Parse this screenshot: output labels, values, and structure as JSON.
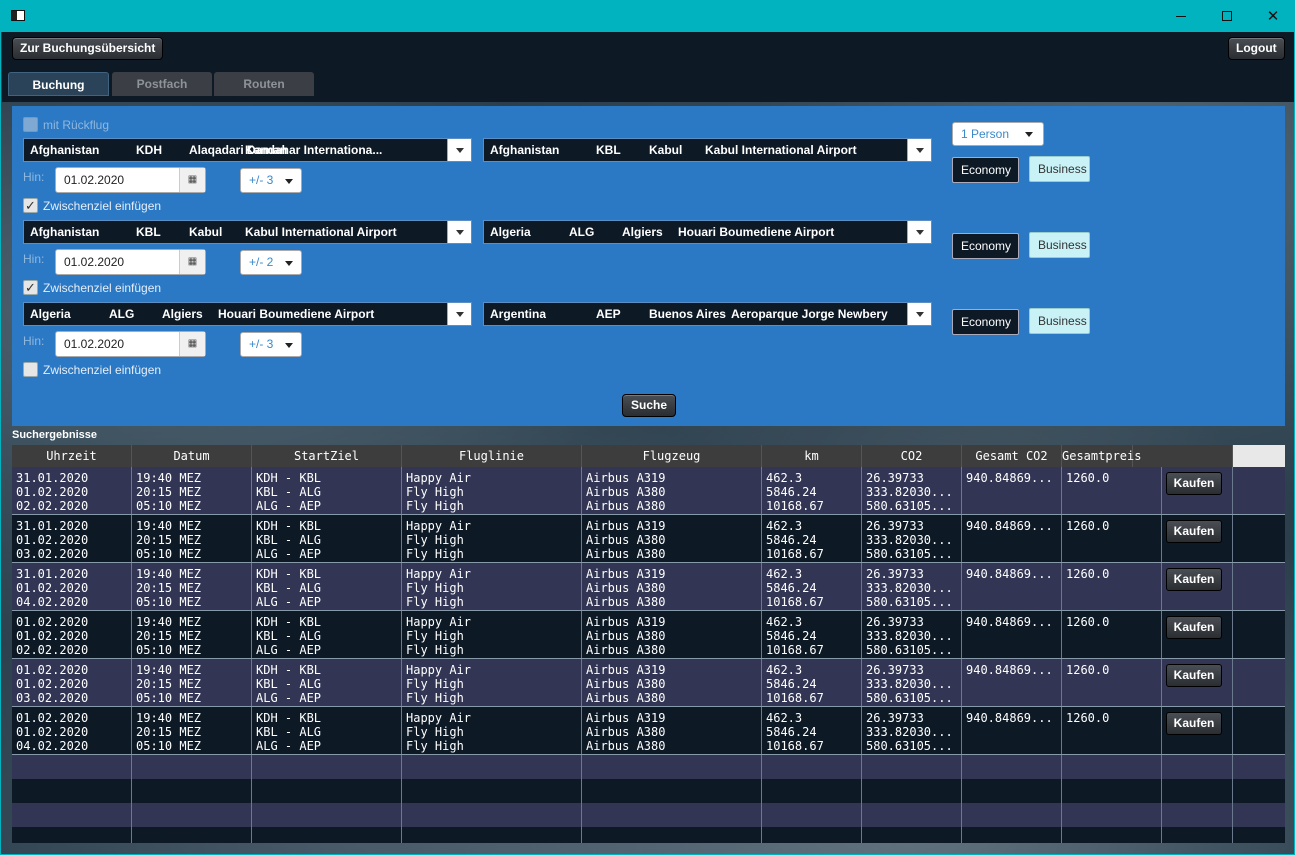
{
  "window": {
    "app_icon": "window-icon",
    "controls": {
      "minimize": "minimize-icon",
      "maximize": "maximize-icon",
      "close": "close-icon",
      "close_glyph": "✕"
    }
  },
  "header": {
    "overview_button": "Zur Buchungsübersicht",
    "logout_button": "Logout"
  },
  "tabs": [
    {
      "label": "Buchung",
      "active": true
    },
    {
      "label": "Postfach",
      "active": false
    },
    {
      "label": "Routen",
      "active": false
    }
  ],
  "search": {
    "return_flight_label": "mit Rückflug",
    "return_flight_checked": false,
    "persons": "1 Person",
    "hin_label": "Hin:",
    "stopover_label": "Zwischenziel einfügen",
    "economy_label": "Economy",
    "business_label": "Business",
    "search_button": "Suche",
    "legs": [
      {
        "from": {
          "country": "Afghanistan",
          "code": "KDH",
          "city": "Alaqadari Daman",
          "airport": "Kandahar Internationa..."
        },
        "to": {
          "country": "Afghanistan",
          "code": "KBL",
          "city": "Kabul",
          "airport": "Kabul International Airport"
        },
        "date": "01.02.2020",
        "flex": "+/- 3",
        "stopover_checked": true
      },
      {
        "from": {
          "country": "Afghanistan",
          "code": "KBL",
          "city": "Kabul",
          "airport": "Kabul International Airport"
        },
        "to": {
          "country": "Algeria",
          "code": "ALG",
          "city": "Algiers",
          "airport": "Houari Boumediene Airport"
        },
        "date": "01.02.2020",
        "flex": "+/- 2",
        "stopover_checked": true
      },
      {
        "from": {
          "country": "Algeria",
          "code": "ALG",
          "city": "Algiers",
          "airport": "Houari Boumediene Airport"
        },
        "to": {
          "country": "Argentina",
          "code": "AEP",
          "city": "Buenos Aires",
          "airport": "Aeroparque Jorge Newbery"
        },
        "date": "01.02.2020",
        "flex": "+/- 3",
        "stopover_checked": false
      }
    ]
  },
  "results": {
    "label": "Suchergebnisse",
    "columns": [
      "Uhrzeit",
      "Datum",
      "StartZiel",
      "Fluglinie",
      "Flugzeug",
      "km",
      "CO2",
      "Gesamt CO2",
      "Gesamtpreis"
    ],
    "buy_label": "Kaufen",
    "rows": [
      {
        "dates": [
          "31.01.2020",
          "01.02.2020",
          "02.02.2020"
        ],
        "times": [
          "19:40 MEZ",
          "20:15 MEZ",
          "05:10 MEZ"
        ],
        "routes": [
          "KDH - KBL",
          "KBL - ALG",
          "ALG - AEP"
        ],
        "airlines": [
          "Happy Air",
          "Fly High",
          "Fly High"
        ],
        "planes": [
          "Airbus A319",
          "Airbus A380",
          "Airbus A380"
        ],
        "km": [
          "462.3",
          "5846.24",
          "10168.67"
        ],
        "co2": [
          "26.39733",
          "333.82030...",
          "580.63105..."
        ],
        "total_co2": "940.84869...",
        "price": "1260.0"
      },
      {
        "dates": [
          "31.01.2020",
          "01.02.2020",
          "03.02.2020"
        ],
        "times": [
          "19:40 MEZ",
          "20:15 MEZ",
          "05:10 MEZ"
        ],
        "routes": [
          "KDH - KBL",
          "KBL - ALG",
          "ALG - AEP"
        ],
        "airlines": [
          "Happy Air",
          "Fly High",
          "Fly High"
        ],
        "planes": [
          "Airbus A319",
          "Airbus A380",
          "Airbus A380"
        ],
        "km": [
          "462.3",
          "5846.24",
          "10168.67"
        ],
        "co2": [
          "26.39733",
          "333.82030...",
          "580.63105..."
        ],
        "total_co2": "940.84869...",
        "price": "1260.0"
      },
      {
        "dates": [
          "31.01.2020",
          "01.02.2020",
          "04.02.2020"
        ],
        "times": [
          "19:40 MEZ",
          "20:15 MEZ",
          "05:10 MEZ"
        ],
        "routes": [
          "KDH - KBL",
          "KBL - ALG",
          "ALG - AEP"
        ],
        "airlines": [
          "Happy Air",
          "Fly High",
          "Fly High"
        ],
        "planes": [
          "Airbus A319",
          "Airbus A380",
          "Airbus A380"
        ],
        "km": [
          "462.3",
          "5846.24",
          "10168.67"
        ],
        "co2": [
          "26.39733",
          "333.82030...",
          "580.63105..."
        ],
        "total_co2": "940.84869...",
        "price": "1260.0"
      },
      {
        "dates": [
          "01.02.2020",
          "01.02.2020",
          "02.02.2020"
        ],
        "times": [
          "19:40 MEZ",
          "20:15 MEZ",
          "05:10 MEZ"
        ],
        "routes": [
          "KDH - KBL",
          "KBL - ALG",
          "ALG - AEP"
        ],
        "airlines": [
          "Happy Air",
          "Fly High",
          "Fly High"
        ],
        "planes": [
          "Airbus A319",
          "Airbus A380",
          "Airbus A380"
        ],
        "km": [
          "462.3",
          "5846.24",
          "10168.67"
        ],
        "co2": [
          "26.39733",
          "333.82030...",
          "580.63105..."
        ],
        "total_co2": "940.84869...",
        "price": "1260.0"
      },
      {
        "dates": [
          "01.02.2020",
          "01.02.2020",
          "03.02.2020"
        ],
        "times": [
          "19:40 MEZ",
          "20:15 MEZ",
          "05:10 MEZ"
        ],
        "routes": [
          "KDH - KBL",
          "KBL - ALG",
          "ALG - AEP"
        ],
        "airlines": [
          "Happy Air",
          "Fly High",
          "Fly High"
        ],
        "planes": [
          "Airbus A319",
          "Airbus A380",
          "Airbus A380"
        ],
        "km": [
          "462.3",
          "5846.24",
          "10168.67"
        ],
        "co2": [
          "26.39733",
          "333.82030...",
          "580.63105..."
        ],
        "total_co2": "940.84869...",
        "price": "1260.0"
      },
      {
        "dates": [
          "01.02.2020",
          "01.02.2020",
          "04.02.2020"
        ],
        "times": [
          "19:40 MEZ",
          "20:15 MEZ",
          "05:10 MEZ"
        ],
        "routes": [
          "KDH - KBL",
          "KBL - ALG",
          "ALG - AEP"
        ],
        "airlines": [
          "Happy Air",
          "Fly High",
          "Fly High"
        ],
        "planes": [
          "Airbus A319",
          "Airbus A380",
          "Airbus A380"
        ],
        "km": [
          "462.3",
          "5846.24",
          "10168.67"
        ],
        "co2": [
          "26.39733",
          "333.82030...",
          "580.63105..."
        ],
        "total_co2": "940.84869...",
        "price": "1260.0"
      }
    ]
  }
}
